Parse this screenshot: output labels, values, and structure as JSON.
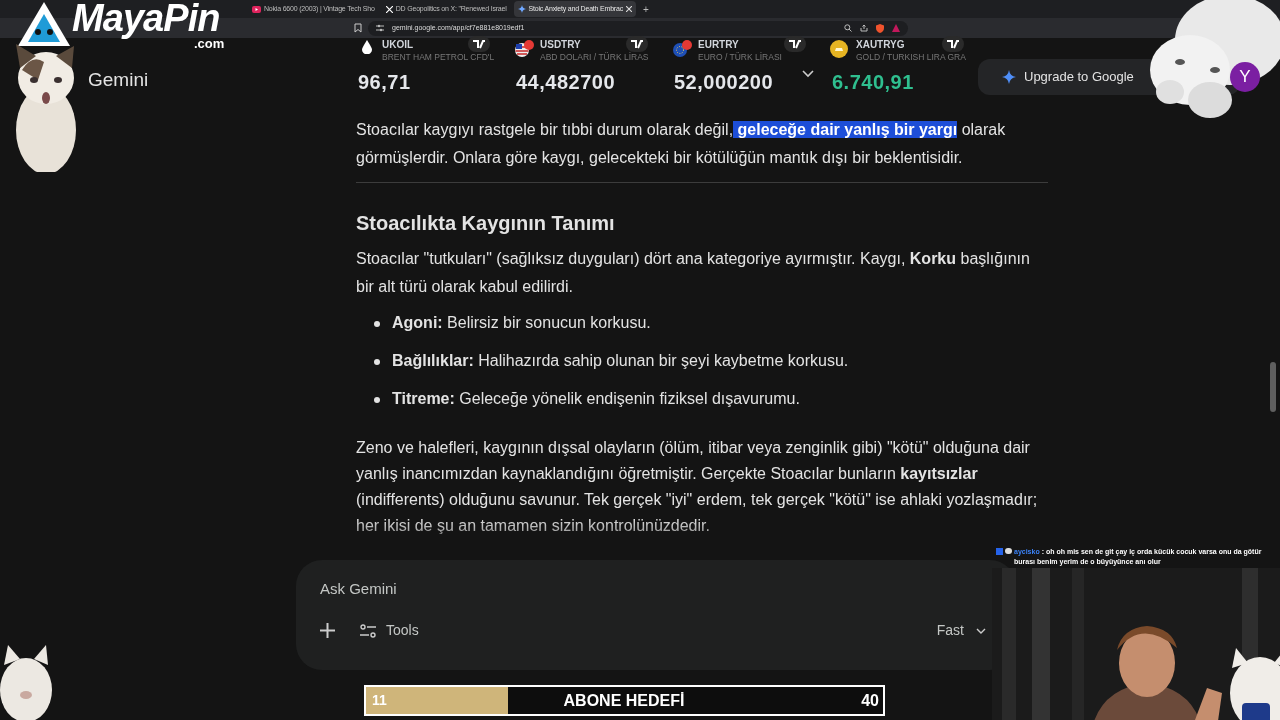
{
  "browser": {
    "tabs": [
      {
        "title": "Nokia 6600 (2003) | Vintage Tech Sho",
        "selected": false
      },
      {
        "title": "DD Geopolitics on X: \"Renewed Israel",
        "selected": false
      },
      {
        "title": "Stoic Anxiety and Death Embrac",
        "selected": true
      }
    ],
    "new_tab": "+",
    "url": "gemini.google.com/app/cf7e881e8019edf1"
  },
  "header": {
    "app_name": "Gemini",
    "upgrade_button": "Upgrade to Google",
    "avatar": "Y"
  },
  "ticker": [
    {
      "symbol": "UKOIL",
      "description": "BRENT HAM PETROL CFD'L",
      "value": "96,71",
      "color": "#e5e7eb"
    },
    {
      "symbol": "USDTRY",
      "description": "ABD DOLARI / TÜRK LİRAS",
      "value": "44,482700",
      "color": "#e5e7eb"
    },
    {
      "symbol": "EURTRY",
      "description": "EURO / TÜRK LİRASI",
      "value": "52,000200",
      "color": "#e5e7eb"
    },
    {
      "symbol": "XAUTRYG",
      "description": "GOLD / TURKISH LIRA GRA",
      "value": "6.740,91",
      "color": "#2fbf8f"
    }
  ],
  "article": {
    "intro": [
      {
        "text": "Stoacılar kaygıyı rastgele bir tıbbi durum olarak değil,",
        "selected": false
      },
      {
        "text": " geleceğe dair yanlış bir yargı",
        "selected": true
      },
      {
        "text": " olarak görmüşlerdir. Onlara göre kaygı, gelecekteki bir kötülüğün mantık dışı bir beklentisidir.",
        "selected": false
      }
    ],
    "heading": "Stoacılıkta Kaygının Tanımı",
    "paragraph": "Stoacılar \"tutkuları\" (sağlıksız duyguları) dört ana kategoriye ayırmıştır. Kaygı, **Korku** başlığının bir alt türü olarak kabul edilirdi.",
    "bullets": [
      "**Agoni:** Belirsiz bir sonucun korkusu.",
      "**Bağlılıklar:** Halihazırda sahip olunan bir şeyi kaybetme korkusu.",
      "**Titreme:** Geleceğe yönelik endişenin fiziksel dışavurumu."
    ],
    "closing": "Zeno ve halefleri, kaygının dışsal olayların (ölüm, itibar veya zenginlik gibi) \"kötü\" olduğuna dair yanlış inancımızdan kaynaklandığını öğretmiştir. Gerçekte Stoacılar bunların **kayıtsızlar** (indifferents) olduğunu savunur. Tek gerçek \"iyi\" erdem, tek gerçek \"kötü\" ise ahlaki yozlaşmadır; her ikisi de şu an tamamen sizin kontrolünüzdedir."
  },
  "composer": {
    "placeholder": "Ask Gemini",
    "tools": "Tools",
    "model": "Fast"
  },
  "overlay": {
    "logo": "MayaPin",
    "logo_suffix": ".com",
    "chat": {
      "user": "aycisko",
      "color": "#3b82f6",
      "separator": ":",
      "message": "oh oh mis sen de git çay iç orda kücük cocuk varsa onu da götür burası benim yerim de o büyüyünce anı olur"
    },
    "goal": {
      "current": "11",
      "label": "ABONE HEDEFİ",
      "target": "40",
      "level": 0.275
    }
  }
}
